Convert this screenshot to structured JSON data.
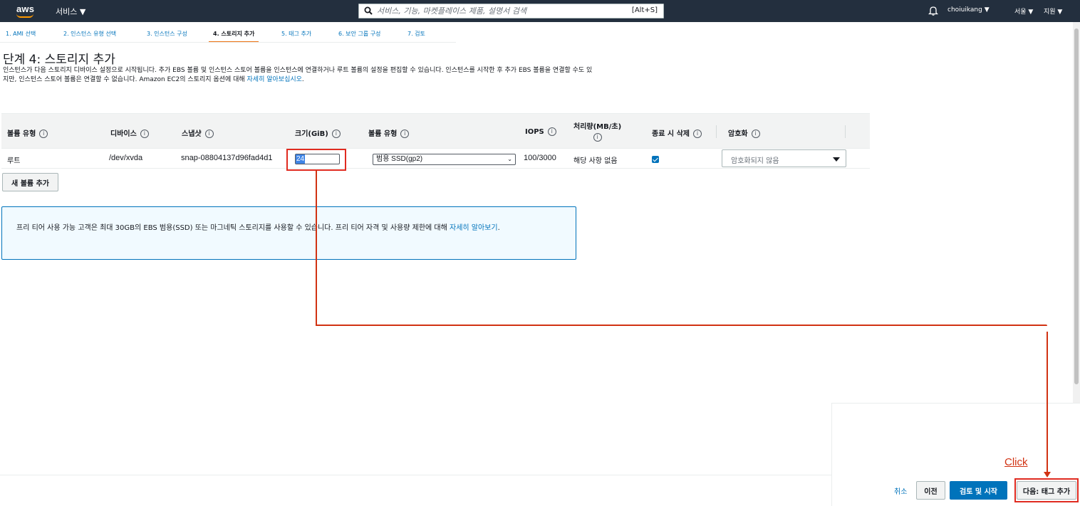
{
  "nav": {
    "logo": "aws",
    "services": "서비스 ▼",
    "search_placeholder": "서비스, 기능, 마켓플레이스 제품, 설명서 검색",
    "search_shortcut": "[Alt+S]",
    "user": "choiuikang ▼",
    "region": "서울 ▼",
    "support": "지원 ▼"
  },
  "wizard": {
    "tabs": [
      {
        "label": "1. AMI 선택"
      },
      {
        "label": "2. 인스턴스 유형 선택"
      },
      {
        "label": "3. 인스턴스 구성"
      },
      {
        "label": "4. 스토리지 추가"
      },
      {
        "label": "5. 태그 추가"
      },
      {
        "label": "6. 보안 그룹 구성"
      },
      {
        "label": "7. 검토"
      }
    ],
    "active_index": 3
  },
  "page": {
    "title": "단계 4: 스토리지 추가",
    "desc_prefix": "인스턴스가 다음 스토리지 디바이스 설정으로 시작됩니다. 추가 EBS 볼륨 및 인스턴스 스토어 볼륨을 인스턴스에 연결하거나 루트 볼륨의 설정을 편집할 수 있습니다. 인스턴스를 시작한 후 추가 EBS 볼륨을 연결할 수도 있지만, 인스턴스 스토어 볼륨은 연결할 수 없습니다. Amazon EC2의 스토리지 옵션에 대해 ",
    "desc_link": "자세히 알아보십시오",
    "desc_suffix": "."
  },
  "table": {
    "headers": {
      "volume_type": "볼륨 유형",
      "device": "디바이스",
      "snapshot": "스냅샷",
      "size": "크기(GiB)",
      "vol_kind": "볼륨 유형",
      "iops": "IOPS",
      "throughput": "처리량(MB/초)",
      "delete_on_term": "종료 시 삭제",
      "encryption": "암호화"
    },
    "info_symbol": "i",
    "row": {
      "volume_type": "루트",
      "device": "/dev/xvda",
      "snapshot": "snap-08804137d96fad4d1",
      "size": "24",
      "vol_kind": "범용 SSD(gp2)",
      "iops": "100/3000",
      "throughput": "해당 사항 없음",
      "encryption": "암호화되지 않음"
    }
  },
  "add_volume_label": "새 볼륨 추가",
  "info_box": {
    "text": "프리 티어 사용 가능 고객은 최대 30GB의 EBS 범용(SSD) 또는 마그네틱 스토리지를 사용할 수 있습니다. 프리 티어 자격 및 사용량 제한에 대해 ",
    "link": "자세히 알아보기",
    "suffix": "."
  },
  "annotation": {
    "click_label": "Click",
    "color": "#d13212"
  },
  "footer": {
    "cancel": "취소",
    "previous": "이전",
    "review_launch": "검토 및 시작",
    "next": "다음: 태그 추가"
  },
  "colors": {
    "nav_bg": "#232f3e",
    "accent_orange": "#ec7211",
    "primary_blue": "#0073bb",
    "info_bg": "#f1faff"
  }
}
